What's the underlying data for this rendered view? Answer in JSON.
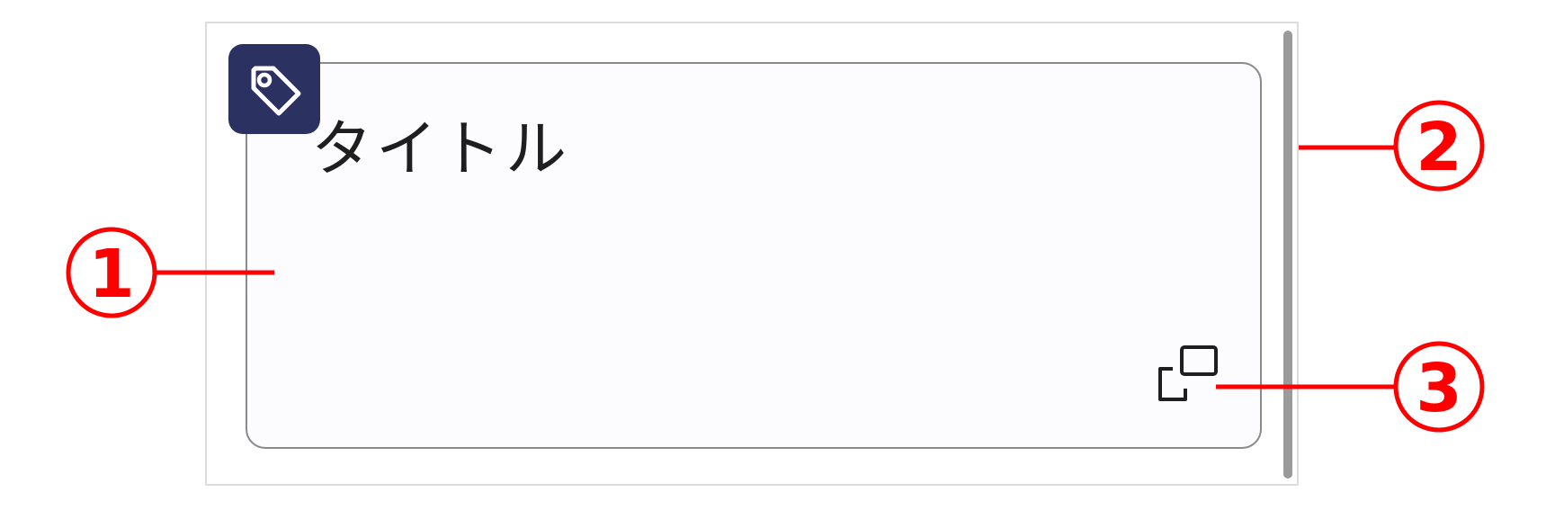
{
  "card": {
    "title": "タイトル"
  },
  "icons": {
    "tag": "tag-icon",
    "expand": "open-in-new-window-icon"
  },
  "callouts": [
    {
      "number": "1"
    },
    {
      "number": "2"
    },
    {
      "number": "3"
    }
  ],
  "colors": {
    "badge": "#2b3160",
    "callout": "#ff0000",
    "card_border": "#8a8a8a",
    "scrollbar": "#9a9a9a"
  }
}
